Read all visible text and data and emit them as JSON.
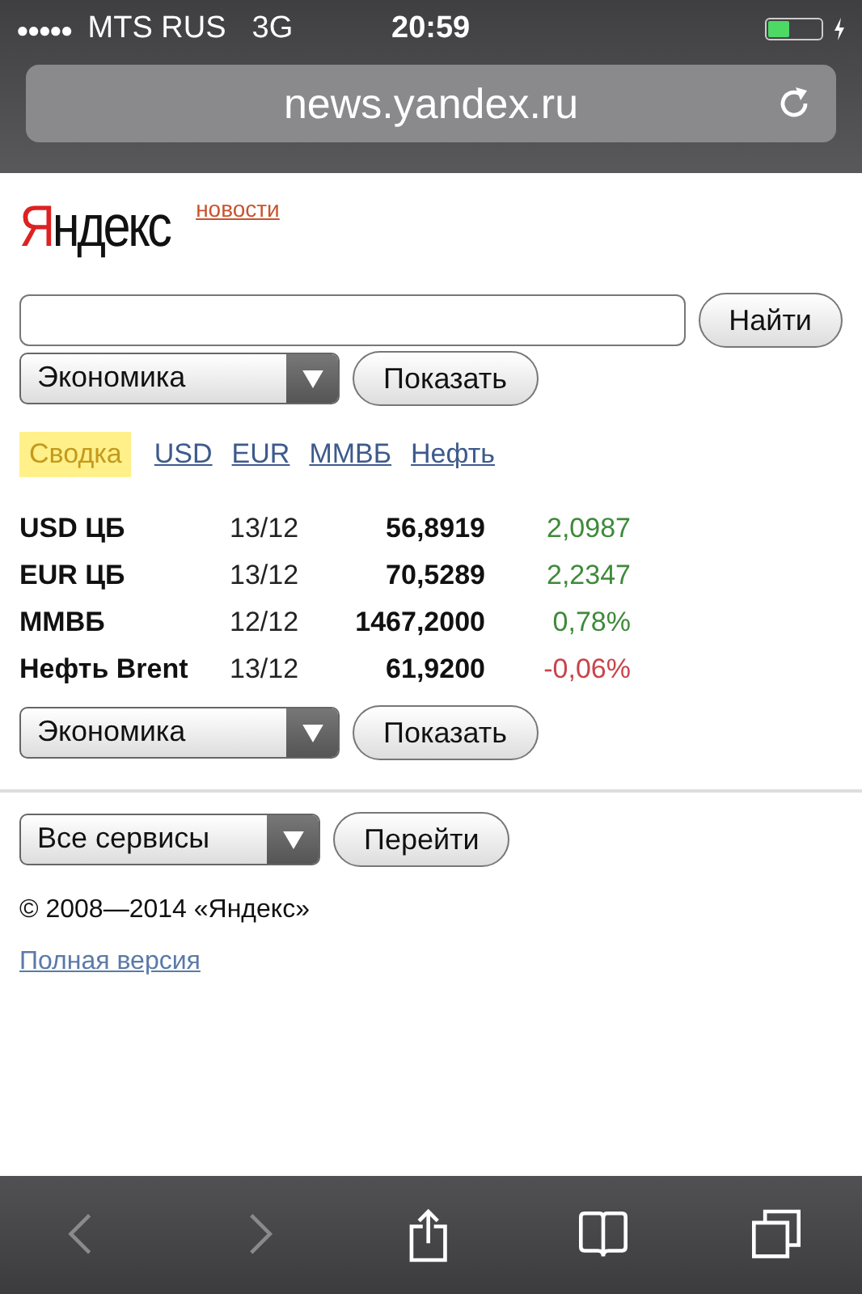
{
  "status_bar": {
    "signal_dots": "●●●●●",
    "carrier": "MTS RUS",
    "network": "3G",
    "time": "20:59"
  },
  "address_bar": {
    "url": "news.yandex.ru"
  },
  "header": {
    "logo": "Яндекс",
    "section_link": "новости"
  },
  "search": {
    "button": "Найти"
  },
  "category_form": {
    "select": "Экономика",
    "button": "Показать"
  },
  "tabs": [
    {
      "label": "Сводка",
      "selected": true
    },
    {
      "label": "USD",
      "selected": false
    },
    {
      "label": "EUR",
      "selected": false
    },
    {
      "label": "ММВБ",
      "selected": false
    },
    {
      "label": "Нефть",
      "selected": false
    }
  ],
  "quotes": [
    {
      "name": "USD ЦБ",
      "date": "13/12",
      "value": "56,8919",
      "change": "2,0987",
      "color": "#3e8a3a"
    },
    {
      "name": "EUR ЦБ",
      "date": "13/12",
      "value": "70,5289",
      "change": "2,2347",
      "color": "#3e8a3a"
    },
    {
      "name": "ММВБ",
      "date": "12/12",
      "value": "1467,2000",
      "change": "0,78%",
      "color": "#3e8a3a"
    },
    {
      "name": "Нефть Brent",
      "date": "13/12",
      "value": "61,9200",
      "change": "-0,06%",
      "color": "#c9444a"
    }
  ],
  "category_form_bottom": {
    "select": "Экономика",
    "button": "Показать"
  },
  "services_form": {
    "select": "Все сервисы",
    "button": "Перейти"
  },
  "copyright": "© 2008—2014 «Яндекс»",
  "full_version_link": "Полная версия",
  "toolbar": {
    "back_disabled": true,
    "forward_disabled": true
  }
}
